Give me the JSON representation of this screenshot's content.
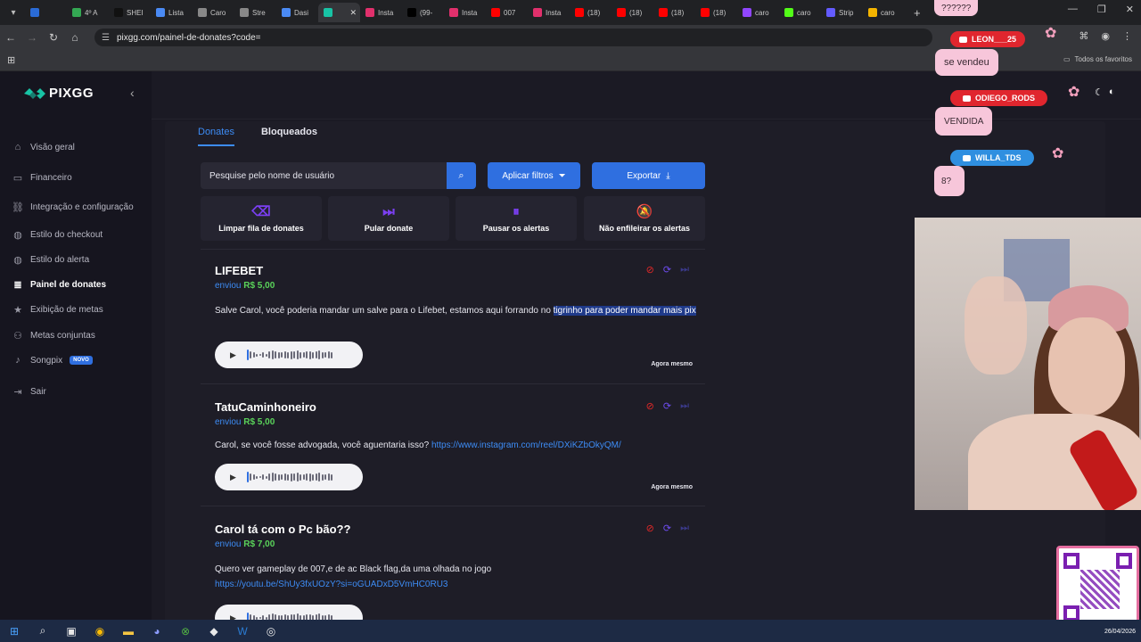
{
  "browser": {
    "tabs": [
      {
        "label": "4º A",
        "color": "#34a853"
      },
      {
        "label": "SHEI",
        "color": "#111111"
      },
      {
        "label": "Lista",
        "color": "#4a8af4"
      },
      {
        "label": "Caro",
        "color": "#888888"
      },
      {
        "label": "Stre",
        "color": "#888888"
      },
      {
        "label": "Dasi",
        "color": "#4a8af4"
      },
      {
        "label": "",
        "color": "#18c3a5",
        "active": true
      },
      {
        "label": "Insta",
        "color": "#e1306c"
      },
      {
        "label": "(99-",
        "color": "#000000"
      },
      {
        "label": "Insta",
        "color": "#e1306c"
      },
      {
        "label": "007",
        "color": "#ff0000"
      },
      {
        "label": "Insta",
        "color": "#e1306c"
      },
      {
        "label": "(18)",
        "color": "#ff0000"
      },
      {
        "label": "(18)",
        "color": "#ff0000"
      },
      {
        "label": "(18)",
        "color": "#ff0000"
      },
      {
        "label": "(18)",
        "color": "#ff0000"
      },
      {
        "label": "caro",
        "color": "#9146ff"
      },
      {
        "label": "caro",
        "color": "#53fc18"
      },
      {
        "label": "Strip",
        "color": "#635bff"
      },
      {
        "label": "caro",
        "color": "#f4b400"
      }
    ],
    "url": "pixgg.com/painel-de-donates?code=",
    "bookmarks_all": "Todos os favoritos"
  },
  "sidebar": {
    "logo": "PIXGG",
    "items": [
      {
        "label": "Visão geral",
        "icon": "home-icon"
      },
      {
        "label": "Financeiro",
        "icon": "wallet-icon"
      },
      {
        "label": "Integração e configuração",
        "icon": "link-icon"
      },
      {
        "label": "Estilo do checkout",
        "icon": "palette-icon"
      },
      {
        "label": "Estilo do alerta",
        "icon": "palette-icon"
      },
      {
        "label": "Painel de donates",
        "icon": "list-icon",
        "active": true
      },
      {
        "label": "Exibição de metas",
        "icon": "star-icon"
      },
      {
        "label": "Metas conjuntas",
        "icon": "group-icon"
      },
      {
        "label": "Songpix",
        "icon": "music-icon",
        "badge": "NOVO"
      },
      {
        "label": "Sair",
        "icon": "logout-icon"
      }
    ]
  },
  "tabs": {
    "donates": "Donates",
    "blocked": "Bloqueados"
  },
  "toolbar": {
    "search_placeholder": "Pesquise pelo nome de usuário",
    "filters": "Aplicar filtros",
    "export": "Exportar"
  },
  "actions": [
    {
      "label": "Limpar fila de donates",
      "icon": "eraser-icon"
    },
    {
      "label": "Pular donate",
      "icon": "skip-icon"
    },
    {
      "label": "Pausar os alertas",
      "icon": "pause-icon"
    },
    {
      "label": "Não enfileirar os alertas",
      "icon": "bell-off-icon"
    }
  ],
  "donates": [
    {
      "name": "LIFEBET",
      "sent": "enviou",
      "amount": "R$ 5,00",
      "message": "Salve Carol, você poderia mandar um salve para o Lifebet, estamos aqui forrando no ",
      "message_highlight": "tigrinho para poder mandar mais pix",
      "link": "",
      "time": "Agora mesmo"
    },
    {
      "name": "TatuCaminhoneiro",
      "sent": "enviou",
      "amount": "R$ 5,00",
      "message": "Carol, se você fosse advogada, você aguentaria isso? ",
      "message_highlight": "",
      "link": "https://www.instagram.com/reel/DXiKZbOkyQM/",
      "time": "Agora mesmo"
    },
    {
      "name": "Carol tá com o Pc bão??",
      "sent": "enviou",
      "amount": "R$ 7,00",
      "message": "Quero ver gameplay de 007,e de ac Black flag,da uma olhada no jogo",
      "message_highlight": "",
      "link": "https://youtu.be/ShUy3fxUOzY?si=oGUADxD5VmHC0RU3",
      "time": ""
    }
  ],
  "overlay": {
    "top_bubble": "??????",
    "chat": [
      {
        "user": "LEON___25",
        "msg": "se vendeu",
        "color": "#e0262e"
      },
      {
        "user": "ODIEGO_RODS",
        "msg": "VENDIDA",
        "color": "#e0262e"
      },
      {
        "user": "WILLA_TDS",
        "msg": "8?",
        "color": "#2f8fe0"
      }
    ]
  },
  "taskbar": {
    "date": "26/04/2026",
    "apps": [
      "windows-icon",
      "search-icon",
      "taskview-icon",
      "chrome-icon",
      "explorer-icon",
      "discord-icon",
      "xbox-icon",
      "shield-icon",
      "word-icon",
      "obs-icon"
    ]
  }
}
